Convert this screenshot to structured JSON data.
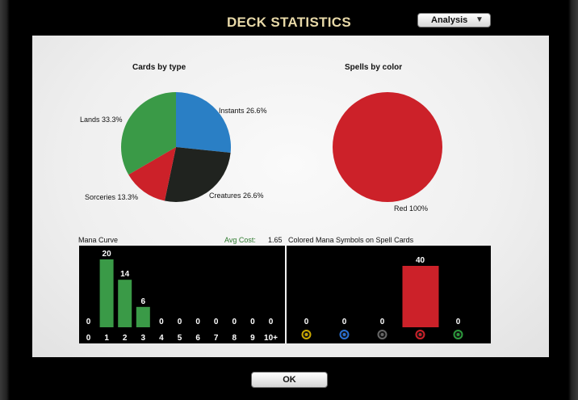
{
  "title": "DECK STATISTICS",
  "view_select": {
    "selected": "Analysis"
  },
  "ok_label": "OK",
  "colors": {
    "green": "#3a9a47",
    "blue": "#2a7fc5",
    "black": "#20231f",
    "red": "#cc2129",
    "panel": "#f0f0f0"
  },
  "chart_data": [
    {
      "type": "pie",
      "title": "Cards by type",
      "slices": [
        {
          "label": "Instants 26.6%",
          "value": 26.6,
          "color": "#2a7fc5"
        },
        {
          "label": "Creatures 26.6%",
          "value": 26.6,
          "color": "#20231f"
        },
        {
          "label": "Sorceries 13.3%",
          "value": 13.3,
          "color": "#cc2129"
        },
        {
          "label": "Lands 33.3%",
          "value": 33.3,
          "color": "#3a9a47"
        }
      ]
    },
    {
      "type": "pie",
      "title": "Spells by color",
      "slices": [
        {
          "label": "Red 100%",
          "value": 100,
          "color": "#cc2129"
        }
      ]
    },
    {
      "type": "bar",
      "title": "Mana Curve",
      "avg_label": "Avg Cost:",
      "avg_value": "1.65",
      "categories": [
        "0",
        "1",
        "2",
        "3",
        "4",
        "5",
        "6",
        "7",
        "8",
        "9",
        "10+"
      ],
      "values": [
        0,
        20,
        14,
        6,
        0,
        0,
        0,
        0,
        0,
        0,
        0
      ],
      "ylim": [
        0,
        20
      ],
      "color": "#3a9a47"
    },
    {
      "type": "bar",
      "title": "Colored Mana Symbols on Spell Cards",
      "categories": [
        "white-mana-icon",
        "blue-mana-icon",
        "black-mana-icon",
        "red-mana-icon",
        "green-mana-icon"
      ],
      "values": [
        0,
        0,
        0,
        40,
        0
      ],
      "ylim": [
        0,
        40
      ],
      "color": "#cc2129",
      "icon_colors": [
        "#c9a800",
        "#2a6fd0",
        "#666666",
        "#cc2129",
        "#2c9a3c"
      ]
    }
  ]
}
